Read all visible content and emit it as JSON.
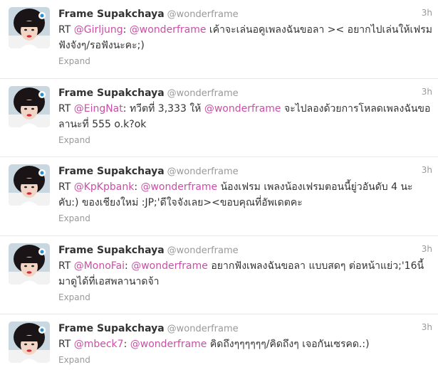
{
  "tweets": [
    {
      "fullname": "Frame Supakchaya",
      "username": "@wonderframe",
      "time": "3h",
      "rt": "RT",
      "mention1": "@Girljung",
      "sep": ":",
      "mention2": "@wonderframe",
      "body": "เค้าจะเล่นอคูเพลงฉันขอลา >< อยากไปเล่นให้เฟรมฟังจังๆ/รอฟังนะคะ;)",
      "expand": "Expand"
    },
    {
      "fullname": "Frame Supakchaya",
      "username": "@wonderframe",
      "time": "3h",
      "rt": "RT",
      "mention1": "@EingNat",
      "sep": ":",
      "pre": "ทวีตที่ 3,333 ให้",
      "mention2": "@wonderframe",
      "body": "จะไปลองด้วยการโหลดเพลงฉันขอลานะที่ 555 o.k?ok",
      "expand": "Expand"
    },
    {
      "fullname": "Frame Supakchaya",
      "username": "@wonderframe",
      "time": "3h",
      "rt": "RT",
      "mention1": "@KpKpbank",
      "sep": ":",
      "mention2": "@wonderframe",
      "body": "น้องเฟรม เพลงน้องเฟรมตอนนี้ยู่วอันดับ 4 นะคับ:) ของเชียงใหม่ :JP;'ดีใจจังเลย><ขอบคุณที่อัพเดตคะ",
      "expand": "Expand"
    },
    {
      "fullname": "Frame Supakchaya",
      "username": "@wonderframe",
      "time": "3h",
      "rt": "RT",
      "mention1": "@MonoFai",
      "sep": ":",
      "mention2": "@wonderframe",
      "body": "อยากฟังเพลงฉันขอลา แบบสดๆ ต่อหน้าแย่ว;'16นี้มาดูได้ที่เอสพลานาดจ้า",
      "expand": "Expand"
    },
    {
      "fullname": "Frame Supakchaya",
      "username": "@wonderframe",
      "time": "3h",
      "rt": "RT",
      "mention1": "@mbeck7",
      "sep": ":",
      "mention2": "@wonderframe",
      "body": "คิดถึงๆๆๆๆๆๆ/คิดถึงๆ เจอกันเซรคด.:)",
      "expand": "Expand"
    }
  ],
  "colors": {
    "mention": "#c94fa5",
    "meta": "#999999",
    "text": "#333333",
    "divider": "#e8e8e8"
  }
}
